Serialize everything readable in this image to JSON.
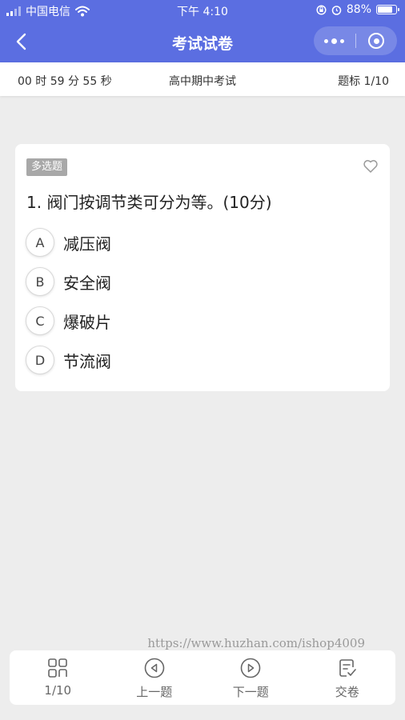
{
  "status_bar": {
    "carrier": "中国电信",
    "time": "下午 4:10",
    "battery": "88%",
    "battery_level": 0.88
  },
  "nav": {
    "title": "考试试卷"
  },
  "info_bar": {
    "timer": "00 时 59 分 55 秒",
    "exam_name": "高中期中考试",
    "progress": "题标 1/10"
  },
  "question": {
    "type_badge": "多选题",
    "text": "1. 阀门按调节类可分为等。(10分)",
    "options": [
      {
        "letter": "A",
        "text": "减压阀"
      },
      {
        "letter": "B",
        "text": "安全阀"
      },
      {
        "letter": "C",
        "text": "爆破片"
      },
      {
        "letter": "D",
        "text": "节流阀"
      }
    ]
  },
  "watermark": "https://www.huzhan.com/ishop4009",
  "toolbar": {
    "items": [
      {
        "label": "1/10",
        "icon": "grid-icon"
      },
      {
        "label": "上一题",
        "icon": "prev-icon"
      },
      {
        "label": "下一题",
        "icon": "next-icon"
      },
      {
        "label": "交卷",
        "icon": "submit-icon"
      }
    ]
  },
  "colors": {
    "primary": "#5b6ee1",
    "background": "#ededed"
  }
}
